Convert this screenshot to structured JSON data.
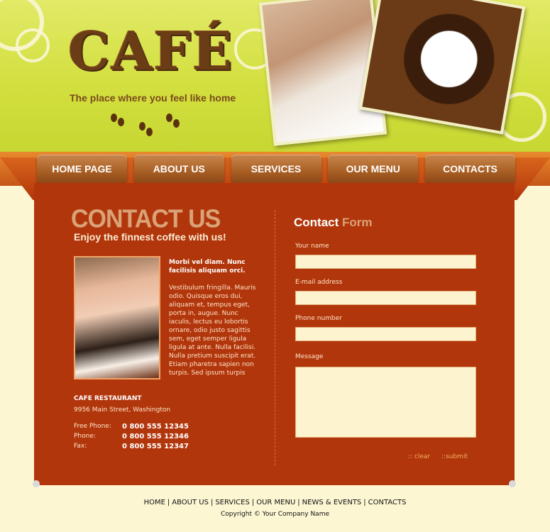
{
  "brand": {
    "logo_text": "CAFÉ",
    "tagline": "The place where you feel like home"
  },
  "nav": {
    "items": [
      "HOME PAGE",
      "ABOUT US",
      "SERVICES",
      "OUR MENU",
      "CONTACTS"
    ]
  },
  "content": {
    "title": "CONTACT US",
    "subtitle": "Enjoy the finnest coffee with us!",
    "lead": "Morbi vel diam. Nunc facilisis aliquam orci.",
    "body": "Vestibulum fringilla. Mauris odio. Quisque eros dui, aliquam et, tempus eget, porta in, augue. Nunc iaculis, lectus eu lobortis ornare, odio justo sagittis sem, eget semper ligula ligula at ante. Nulla facilisi. Nulla pretium suscipit erat. Etiam pharetra sapien non turpis. Sed ipsum turpis"
  },
  "address": {
    "name": "CAFE RESTAURANT",
    "street": "9956 Main Street, Washington",
    "phones": [
      {
        "label": "Free Phone:",
        "value": "0 800 555 12345"
      },
      {
        "label": "Phone:",
        "value": "0 800 555 12346"
      },
      {
        "label": "Fax:",
        "value": "0 800 555 12347"
      }
    ]
  },
  "form": {
    "title_part1": "Contact",
    "title_part2": "Form",
    "name_label": "Your name",
    "email_label": "E-mail address",
    "phone_label": "Phone number",
    "message_label": "Message",
    "name_value": "",
    "email_value": "",
    "phone_value": "",
    "message_value": "",
    "clear_label": ":: clear",
    "submit_label": "::submit"
  },
  "footer": {
    "links": [
      "HOME",
      "ABOUT US",
      "SERVICES",
      "OUR MENU",
      "NEWS & EVENTS",
      "CONTACTS"
    ],
    "copyright": "Copyright © Your Company Name"
  },
  "colors": {
    "header": "#d2df3e",
    "panel": "#b2360b",
    "accent": "#d9a277",
    "background": "#fdf6d3"
  }
}
